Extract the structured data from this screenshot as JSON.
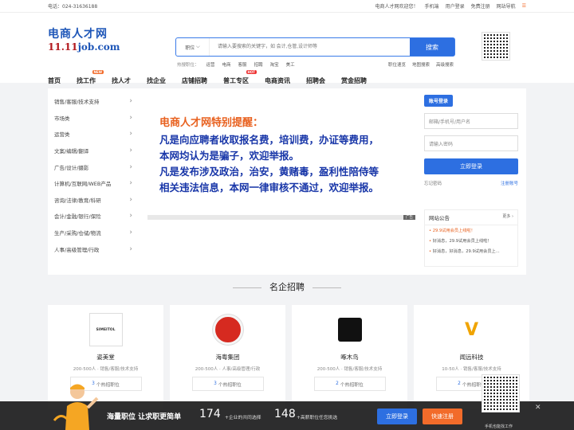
{
  "topbar": {
    "phone": "电话：024-31636188",
    "welcome": "电商人才网欢迎您！",
    "links": [
      "手机端",
      "用户登录",
      "免费注册",
      "网站导航"
    ]
  },
  "logo": {
    "line1": "电商人才网",
    "line2_red": "11.11",
    "line2_blue": "job.com"
  },
  "search": {
    "category": "职位",
    "placeholder": "请输入要搜索的关键字，如 会计,仓管,设计师等",
    "button": "搜索"
  },
  "hot": {
    "label": "热搜职位：",
    "items": [
      "运营",
      "电商",
      "客服",
      "招聘",
      "淘宝",
      "美工"
    ],
    "right_links": [
      "职位速览",
      "地图搜索",
      "高级搜索"
    ]
  },
  "nav": {
    "items": [
      "首页",
      "找工作",
      "找人才",
      "找企业",
      "店铺招聘",
      "普工专区",
      "电商资讯",
      "招聘会",
      "赏金招聘"
    ],
    "badges": {
      "new": "NEW",
      "hot": "HOT"
    }
  },
  "categories": [
    "销售/客服/技术支持",
    "市场类",
    "运营类",
    "文案/编辑/翻译",
    "广告/设计/摄影",
    "计算机/互联网/WEB产品",
    "咨询/法律/教育/科研",
    "会计/金融/银行/保险",
    "生产/采购/仓储/物流",
    "人事/高级管理/行政"
  ],
  "notice": {
    "title": "电商人才网特别提醒：",
    "lines": [
      "凡是向应聘者收取报名费，培训费，办证等费用，",
      "本网均认为是骗子，欢迎举报。",
      "凡是发布涉及政治，治安，黄赌毒，盈利性陪侍等",
      "相关违法信息，本网一律审核不通过，欢迎举报。"
    ],
    "slide_tag": "广告"
  },
  "login": {
    "tab": "账号登录",
    "user_placeholder": "邮箱/手机号/用户名",
    "pass_placeholder": "请输入密码",
    "button": "立即登录",
    "forgot": "忘记密码",
    "register": "注册账号"
  },
  "announcement": {
    "title": "网站公告",
    "more": "更多",
    "items": [
      "29.9试用会员上线啦！",
      "好消息，29.9试用会员上线啦！",
      "好消息，好消息，29.9试用会员上..."
    ]
  },
  "section_title": "名企招聘",
  "companies": [
    {
      "logo_text": "SIMEITOL",
      "name": "姿美堂",
      "meta": "200-500人 · 销售/客服/技术支持",
      "count": "3",
      "suffix": "个热招职位"
    },
    {
      "logo_text": "",
      "name": "海粤集团",
      "meta": "200-500人 · 人事/高级管理/行政",
      "count": "3",
      "suffix": "个热招职位"
    },
    {
      "logo_text": "",
      "name": "啄木鸟",
      "meta": "200-500人 · 销售/客服/技术支持",
      "count": "2",
      "suffix": "个热招职位"
    },
    {
      "logo_text": "",
      "name": "闻远科技",
      "meta": "10-50人 · 销售/客服/技术支持",
      "count": "2",
      "suffix": "个热招职位"
    }
  ],
  "bottom": {
    "slogan": "海量职位 让求职更简单",
    "num1": "174",
    "txt1": "+企业的共同选择",
    "num2": "148",
    "txt2": "+高薪职位任您挑选",
    "login": "立即登录",
    "register": "快速注册",
    "qr_caption": "手机也能找工作"
  },
  "colors": {
    "primary": "#2d6fe1",
    "orange": "#f26b2a",
    "notice_blue": "#1836a8"
  }
}
